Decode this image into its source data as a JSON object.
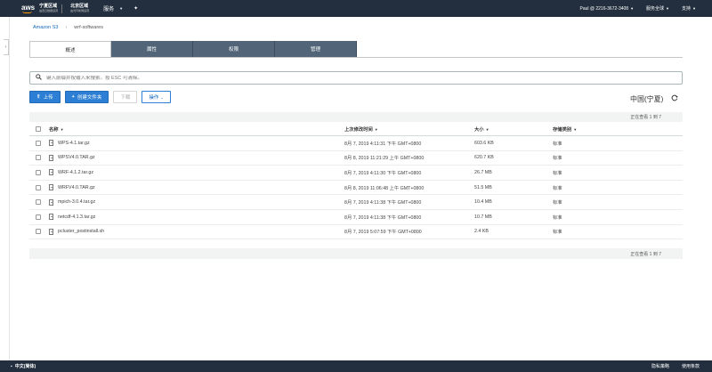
{
  "topbar": {
    "brand": "aws",
    "region_title_1": "宁夏区域",
    "region_sub_1": "由西云数据运营",
    "region_title_2": "北京区域",
    "region_sub_2": "由光环新网运营",
    "services_label": "服务",
    "account_label": "Paul @ 2216-3672-3408",
    "region_menu_label": "服务全球",
    "support_label": "支持"
  },
  "breadcrumb": {
    "root": "Amazon S3",
    "separator": "›",
    "current": "wrf-softwares"
  },
  "tabs": [
    {
      "label": "概述"
    },
    {
      "label": "属性"
    },
    {
      "label": "权限"
    },
    {
      "label": "管理"
    }
  ],
  "search": {
    "placeholder": "键入前缀并按输入来搜索。按 ESC 可清除。"
  },
  "toolbar": {
    "upload_label": "上传",
    "create_folder_label": "创建文件夹",
    "download_label": "下载",
    "actions_label": "操作"
  },
  "region_name": "中国(宁夏)",
  "viewing_text": "正在查看 1 到 7",
  "table": {
    "columns": [
      "名称",
      "上次修改时间",
      "大小",
      "存储类别"
    ],
    "rows": [
      {
        "name": "WPS-4.1.tar.gz",
        "modified": "8月 7, 2019 4:11:31 下午 GMT+0800",
        "size": "603.6 KB",
        "class": "标准"
      },
      {
        "name": "WPSV4.0.TAR.gz",
        "modified": "8月 8, 2019 11:21:29 上午 GMT+0800",
        "size": "620.7 KB",
        "class": "标准"
      },
      {
        "name": "WRF-4.1.2.tar.gz",
        "modified": "8月 7, 2019 4:11:30 下午 GMT+0800",
        "size": "26.7 MB",
        "class": "标准"
      },
      {
        "name": "WRFV4.0.TAR.gz",
        "modified": "8月 8, 2019 11:06:48 上午 GMT+0800",
        "size": "51.5 MB",
        "class": "标准"
      },
      {
        "name": "mpich-3.0.4.tar.gz",
        "modified": "8月 7, 2019 4:11:38 下午 GMT+0800",
        "size": "10.4 MB",
        "class": "标准"
      },
      {
        "name": "netcdf-4.1.3.tar.gz",
        "modified": "8月 7, 2019 4:11:38 下午 GMT+0800",
        "size": "10.7 MB",
        "class": "标准"
      },
      {
        "name": "pcluster_postinstall.sh",
        "modified": "8月 7, 2019 5:07:59 下午 GMT+0800",
        "size": "2.4 KB",
        "class": "标准"
      }
    ]
  },
  "footer": {
    "language": "中文(简体)",
    "privacy": "隐私策略",
    "terms": "使用条款"
  },
  "colors": {
    "header_bg": "#232f3e",
    "tab_bg": "#516478",
    "primary": "#2c7fd4"
  }
}
